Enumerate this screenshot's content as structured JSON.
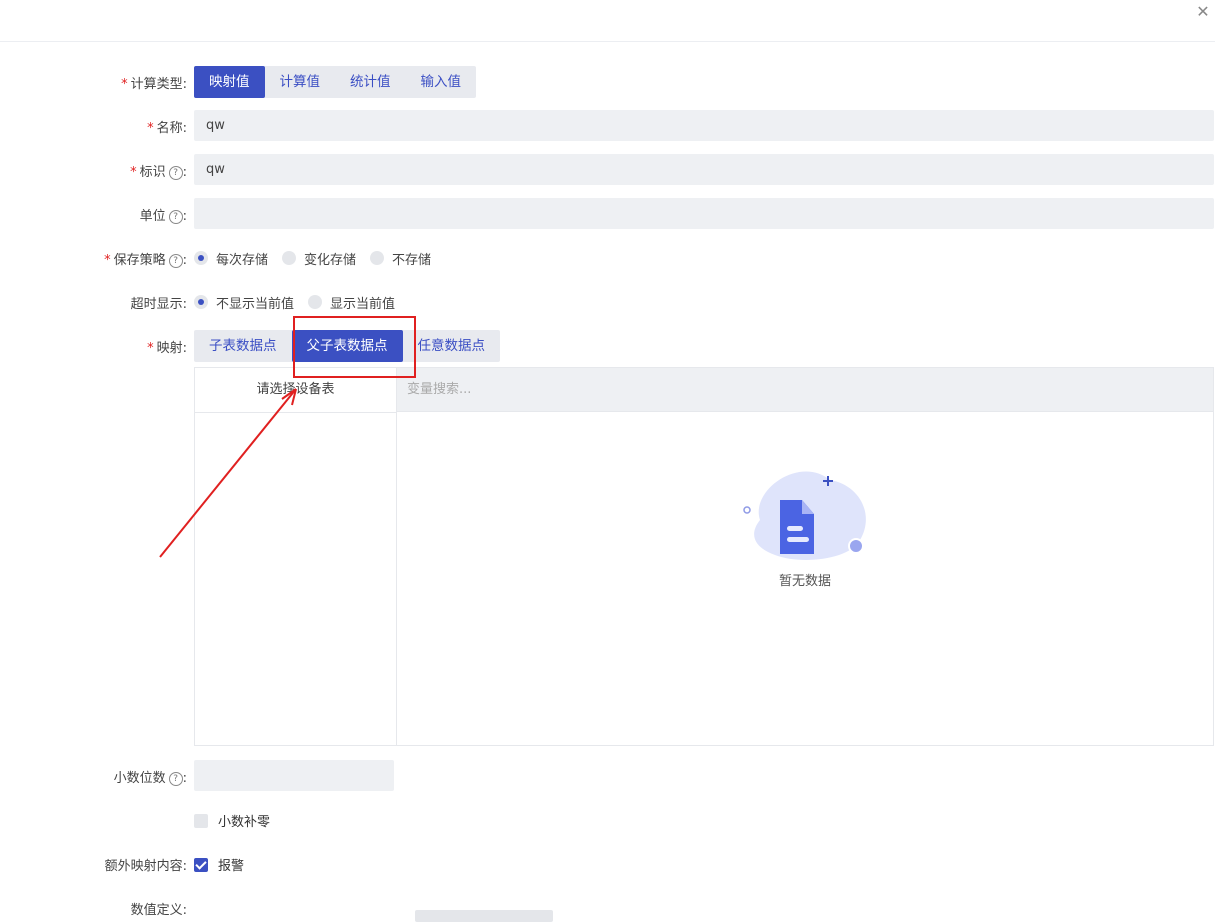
{
  "dialog": {
    "close_icon": "close-icon"
  },
  "form": {
    "calc_type": {
      "label": "计算类型:",
      "options": [
        "映射值",
        "计算值",
        "统计值",
        "输入值"
      ],
      "active": 0
    },
    "name": {
      "label": "名称:",
      "value": "qw"
    },
    "identifier": {
      "label": "标识",
      "value": "qw"
    },
    "unit": {
      "label": "单位",
      "value": ""
    },
    "save_strategy": {
      "label": "保存策略",
      "options": [
        "每次存储",
        "变化存储",
        "不存储"
      ],
      "selected": 0
    },
    "timeout_display": {
      "label": "超时显示:",
      "options": [
        "不显示当前值",
        "显示当前值"
      ],
      "selected": 0
    },
    "mapping": {
      "label": "映射:",
      "options": [
        "子表数据点",
        "父子表数据点",
        "任意数据点"
      ],
      "active": 1
    },
    "table_select": {
      "placeholder": "请选择设备表"
    },
    "var_search": {
      "placeholder": "变量搜索..."
    },
    "empty": {
      "text": "暂无数据"
    },
    "decimal_places": {
      "label": "小数位数"
    },
    "decimal_pad": {
      "label": "小数补零",
      "checked": false
    },
    "extra_mapping": {
      "label": "额外映射内容:",
      "option": "报警",
      "checked": true
    },
    "value_def": {
      "label": "数值定义:"
    }
  },
  "colors": {
    "accent": "#3b50c2",
    "required": "#e02020",
    "highlight": "#e02020"
  }
}
